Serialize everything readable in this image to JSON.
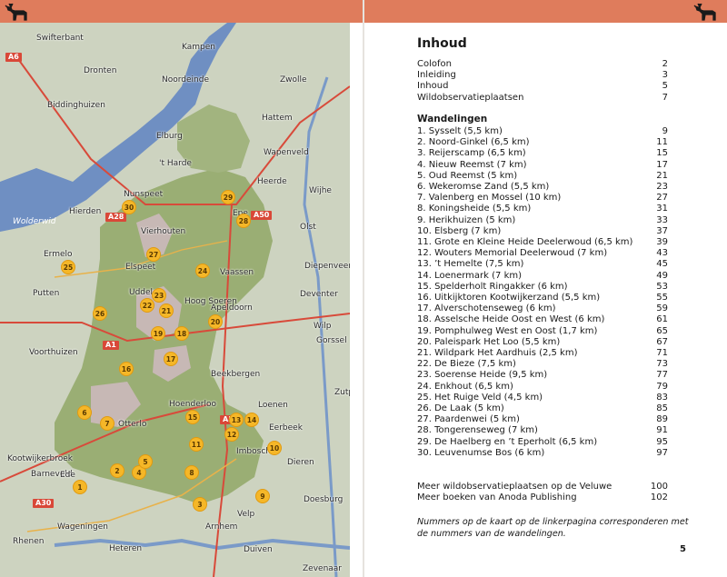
{
  "contents": {
    "title": "Inhoud",
    "front": [
      {
        "label": "Colofon",
        "page": "2"
      },
      {
        "label": "Inleiding",
        "page": "3"
      },
      {
        "label": "Inhoud",
        "page": "5"
      },
      {
        "label": "Wildobservatieplaatsen",
        "page": "7"
      }
    ],
    "walks_heading": "Wandelingen",
    "walks": [
      {
        "label": "1. Sysselt (5,5 km)",
        "page": "9"
      },
      {
        "label": "2. Noord-Ginkel (6,5 km)",
        "page": "11"
      },
      {
        "label": "3. Reijerscamp (6,5 km)",
        "page": "15"
      },
      {
        "label": "4. Nieuw Reemst (7 km)",
        "page": "17"
      },
      {
        "label": "5. Oud Reemst (5 km)",
        "page": "21"
      },
      {
        "label": "6. Wekeromse Zand (5,5 km)",
        "page": "23"
      },
      {
        "label": "7. Valenberg en Mossel (10 km)",
        "page": "27"
      },
      {
        "label": "8. Koningsheide (5,5 km)",
        "page": "31"
      },
      {
        "label": "9. Herikhuizen (5 km)",
        "page": "33"
      },
      {
        "label": "10. Elsberg (7 km)",
        "page": "37"
      },
      {
        "label": "11. Grote en Kleine Heide Deelerwoud (6,5 km)",
        "page": "39"
      },
      {
        "label": "12. Wouters Memorial Deelerwoud (7 km)",
        "page": "43"
      },
      {
        "label": "13. ’t Hemelte (7,5 km)",
        "page": "45"
      },
      {
        "label": "14. Loenermark (7 km)",
        "page": "49"
      },
      {
        "label": "15. Spelderholt Ringakker (6 km)",
        "page": "53"
      },
      {
        "label": "16. Uitkijktoren Kootwijkerzand (5,5 km)",
        "page": "55"
      },
      {
        "label": "17. Alverschotenseweg (6 km)",
        "page": "59"
      },
      {
        "label": "18. Asselsche Heide Oost en West (6 km)",
        "page": "61"
      },
      {
        "label": "19. Pomphulweg West en Oost (1,7 km)",
        "page": "65"
      },
      {
        "label": "20. Paleispark Het Loo (5,5 km)",
        "page": "67"
      },
      {
        "label": "21. Wildpark Het Aardhuis (2,5 km)",
        "page": "71"
      },
      {
        "label": "22. De Bieze (7,5 km)",
        "page": "73"
      },
      {
        "label": "23. Soerense Heide (9,5 km)",
        "page": "77"
      },
      {
        "label": "24. Enkhout (6,5 km)",
        "page": "79"
      },
      {
        "label": "25. Het Ruige Veld (4,5 km)",
        "page": "83"
      },
      {
        "label": "26. De Laak (5 km)",
        "page": "85"
      },
      {
        "label": "27. Paardenwei (5 km)",
        "page": "89"
      },
      {
        "label": "28. Tongerenseweg (7 km)",
        "page": "91"
      },
      {
        "label": "29. De Haelberg en ’t Eperholt (6,5 km)",
        "page": "95"
      },
      {
        "label": "30. Leuvenumse Bos (6 km)",
        "page": "97"
      }
    ],
    "more": [
      {
        "label": "Meer wildobservatieplaatsen op de Veluwe",
        "page": "100"
      },
      {
        "label": "Meer boeken van Anoda Publishing",
        "page": "102"
      }
    ],
    "note": "Nummers op de kaart op de linkerpagina corresponderen met de nummers van de wandelingen.",
    "page_number": "5"
  },
  "map": {
    "places": [
      "Swifterbant",
      "Dronten",
      "Biddinghuizen",
      "Kampen",
      "Noordeinde",
      "Zwolle",
      "Hattem",
      "Elburg",
      "Wapenveld",
      "'t Harde",
      "Heerde",
      "Wijhe",
      "Nunspeet",
      "Hierden",
      "Epe",
      "Olst",
      "Vierhouten",
      "Ermelo",
      "Elspeet",
      "Vaassen",
      "Diepenveen",
      "Putten",
      "Uddel",
      "Deventer",
      "Hoog Soeren",
      "Apeldoorn",
      "Wilp",
      "Voorthuizen",
      "Gorssel",
      "Kootwijkerbroek",
      "Beekbergen",
      "Barneveld",
      "Zutph",
      "Otterlo",
      "Hoenderloo",
      "Loenen",
      "Eerbeek",
      "Imbosch",
      "Ede",
      "Dieren",
      "Doesburg",
      "Wageningen",
      "Velp",
      "Arnhem",
      "Rhenen",
      "Heteren",
      "Duiven",
      "Zevenaar"
    ],
    "water_label": "Wolderwid",
    "roads": [
      "A6",
      "A28",
      "A50",
      "A1",
      "A30",
      "A50"
    ],
    "markers": [
      "1",
      "2",
      "3",
      "4",
      "5",
      "6",
      "7",
      "8",
      "9",
      "10",
      "11",
      "12",
      "13",
      "14",
      "15",
      "16",
      "17",
      "18",
      "19",
      "20",
      "21",
      "22",
      "23",
      "24",
      "25",
      "26",
      "27",
      "28",
      "29",
      "30"
    ]
  }
}
